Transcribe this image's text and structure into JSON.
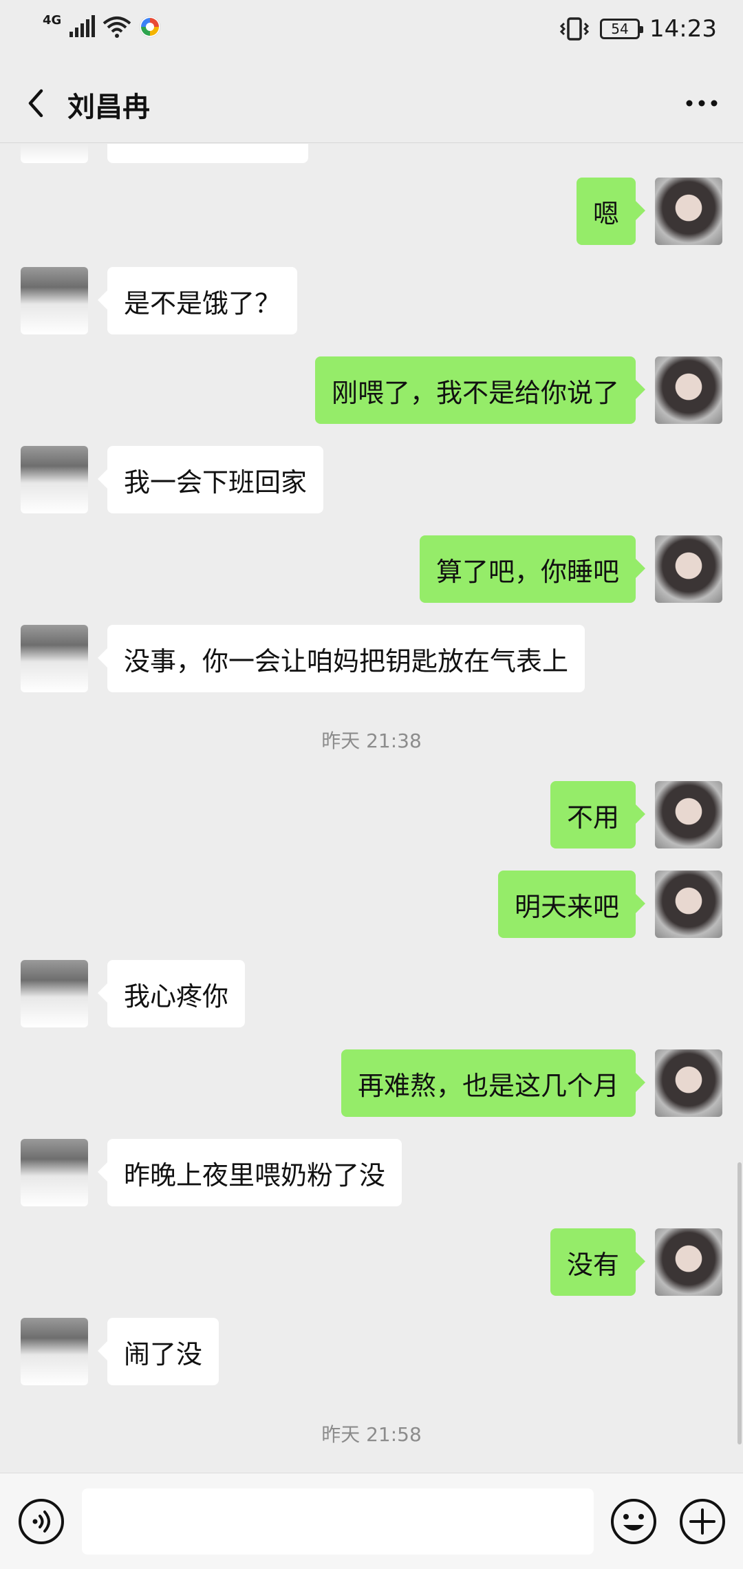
{
  "status_bar": {
    "network": "4G",
    "battery": "54",
    "time": "14:23"
  },
  "header": {
    "title": "刘昌冉"
  },
  "messages": [
    {
      "side": "right",
      "text": "嗯"
    },
    {
      "side": "left",
      "text": "是不是饿了？"
    },
    {
      "side": "right",
      "text": "刚喂了，我不是给你说了"
    },
    {
      "side": "left",
      "text": "我一会下班回家"
    },
    {
      "side": "right",
      "text": "算了吧，你睡吧"
    },
    {
      "side": "left",
      "text": "没事，你一会让咱妈把钥匙放在气表上"
    },
    {
      "side": "right",
      "text": "不用"
    },
    {
      "side": "right",
      "text": "明天来吧"
    },
    {
      "side": "left",
      "text": "我心疼你"
    },
    {
      "side": "right",
      "text": "再难熬，也是这几个月"
    },
    {
      "side": "left",
      "text": "昨晚上夜里喂奶粉了没"
    },
    {
      "side": "right",
      "text": "没有"
    },
    {
      "side": "left",
      "text": "闹了没"
    }
  ],
  "timestamps": [
    "昨天 21:38",
    "昨天 21:58"
  ],
  "input": {
    "placeholder": ""
  },
  "colors": {
    "background": "#ededed",
    "bubble_sent": "#95ec69",
    "bubble_received": "#ffffff"
  },
  "icons": {
    "back": "chevron-left-icon",
    "more": "more-dots-icon",
    "voice": "voice-icon",
    "emoji": "emoji-icon",
    "plus": "plus-icon"
  }
}
